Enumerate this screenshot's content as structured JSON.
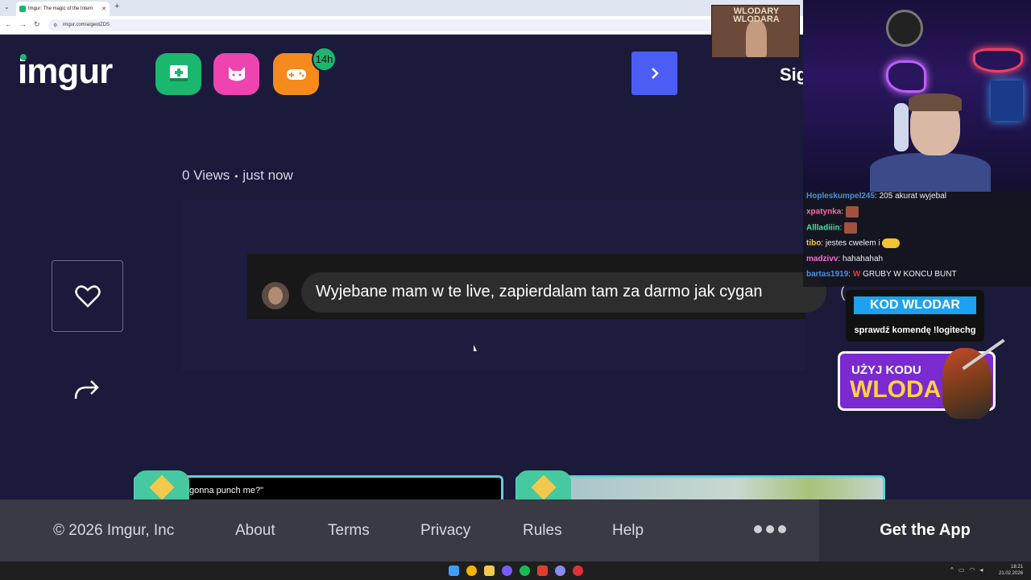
{
  "browser": {
    "tab_title": "Imgur: The magic of the Intern",
    "tab_close": "✕",
    "new_tab": "+",
    "url": "imgur.com/a/geotZDS"
  },
  "header": {
    "logo": "imgur",
    "badge": "14h",
    "sign_in": "Sign in"
  },
  "post": {
    "views": "0 Views",
    "time": "just now",
    "caption": "Wyjebane mam w te live, zapierdalam tam za darmo jak cygan",
    "caption_tail": "("
  },
  "thumbs": [
    {
      "caption": "gonna punch me?\""
    }
  ],
  "footer": {
    "copyright": "© 2026 Imgur, Inc",
    "about": "About",
    "terms": "Terms",
    "privacy": "Privacy",
    "rules": "Rules",
    "help": "Help",
    "get_app": "Get the App"
  },
  "taskbar": {
    "time": "18:21",
    "date": "21.02.2026"
  },
  "stream": {
    "wlodary_title": "WLODARY WLODARA",
    "chat": [
      {
        "user": "Hopleskumpel245",
        "msg": ": 205 akurat wyjebal"
      },
      {
        "user": "xpatynka",
        "msg": ":"
      },
      {
        "user": "Allladiiin",
        "msg": ":"
      },
      {
        "user": "tibo",
        "msg": ": jestes cwelem i"
      },
      {
        "user": "madzivv",
        "msg": ": hahahahah"
      },
      {
        "user": "bartas1919",
        "msg": ":",
        "tail": "GRUBY W KONCU BUNT"
      }
    ],
    "kod_title": "KOD WLODAR",
    "kod_sub": "sprawdź komendę !logitechg",
    "uzyj_line1": "UŻYJ KODU",
    "uzyj_line2": "WLODAR"
  },
  "colors": {
    "page_bg": "#1b1a3a",
    "imgur_green": "#1bb76e",
    "upload_green": "#1bb76e",
    "cat_pink": "#ef44b0",
    "game_orange": "#f78a1d",
    "next_blue": "#4c5df5",
    "footer_bg": "#3a3a45"
  }
}
